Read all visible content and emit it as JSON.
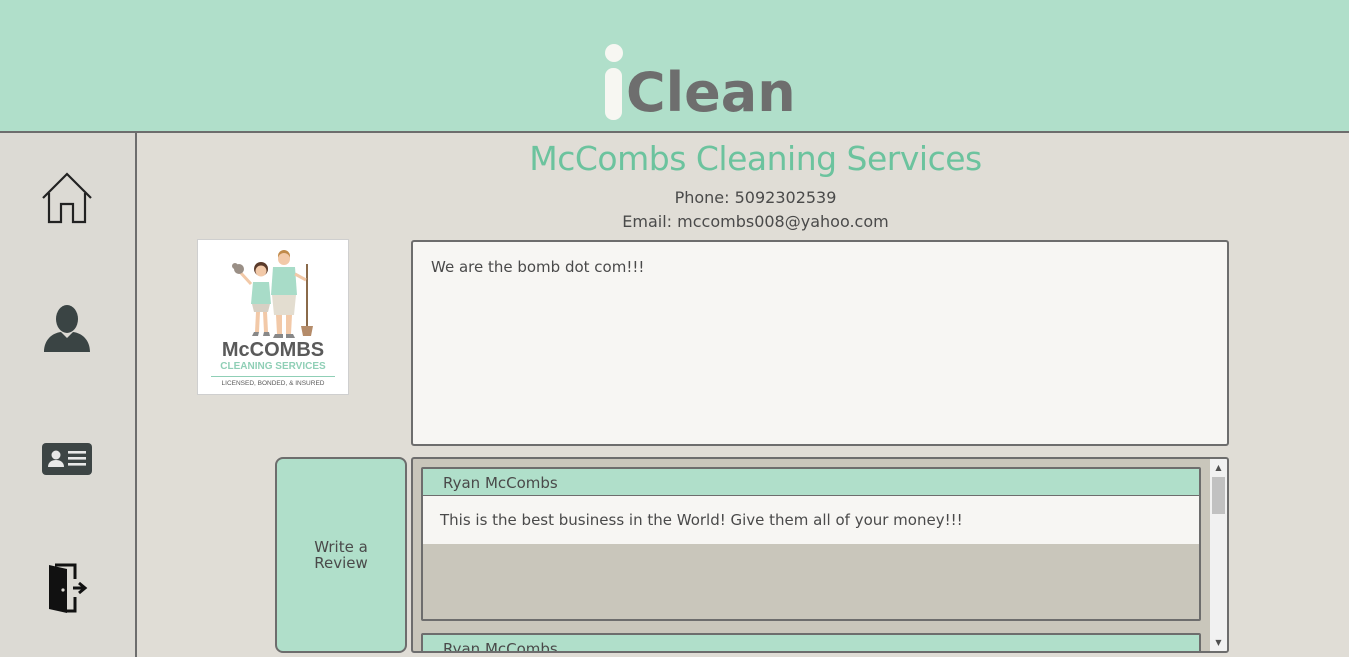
{
  "header": {
    "logo_i": "i",
    "logo_text": "Clean"
  },
  "sidebar": {
    "items": [
      {
        "name": "home",
        "icon": "house-icon"
      },
      {
        "name": "profile",
        "icon": "user-icon"
      },
      {
        "name": "contact-card",
        "icon": "id-card-icon"
      },
      {
        "name": "logout",
        "icon": "exit-door-icon"
      }
    ]
  },
  "business": {
    "name": "McCombs Cleaning Services",
    "phone": "Phone: 5092302539",
    "email": "Email: mccombs008@yahoo.com",
    "logo": {
      "title": "McCOMBS",
      "subtitle": "CLEANING SERVICES",
      "tagline": "LICENSED, BONDED, & INSURED"
    },
    "about": "We are the bomb dot com!!!"
  },
  "write_review_label": "Write a Review",
  "reviews": [
    {
      "author": "Ryan McCombs",
      "text": "This is the best business in the World! Give them all of your money!!!"
    },
    {
      "author": "Ryan McCombs",
      "text": ""
    }
  ],
  "colors": {
    "accent": "#b0dfca",
    "title": "#6cc39e",
    "background": "#e0ddd6",
    "border": "#6d6d6d"
  }
}
